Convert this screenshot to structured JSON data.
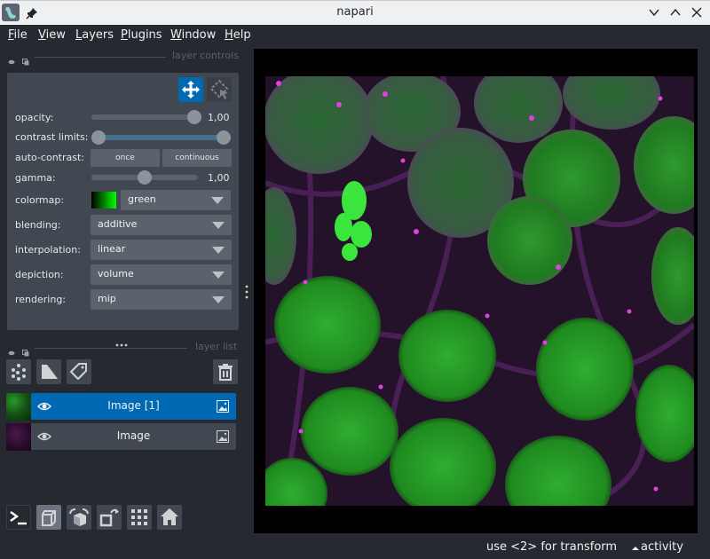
{
  "window": {
    "title": "napari",
    "buttons": {
      "minimize": "chevron-down",
      "maximize": "chevron-up",
      "close": "close"
    }
  },
  "menubar": {
    "items": [
      {
        "label": "File",
        "mnemonic": "F",
        "rest": "ile"
      },
      {
        "label": "View",
        "mnemonic": "V",
        "rest": "iew"
      },
      {
        "label": "Layers",
        "mnemonic": "L",
        "rest": "ayers"
      },
      {
        "label": "Plugins",
        "mnemonic": "P",
        "rest": "lugins"
      },
      {
        "label": "Window",
        "mnemonic": "W",
        "rest": "indow"
      },
      {
        "label": "Help",
        "mnemonic": "H",
        "rest": "elp"
      }
    ]
  },
  "layer_controls": {
    "dock_title": "layer controls",
    "modes": [
      {
        "name": "pan-zoom",
        "active": true
      },
      {
        "name": "transform",
        "active": false
      }
    ],
    "opacity": {
      "label": "opacity:",
      "value": 1.0,
      "display": "1,00"
    },
    "contrast_limits": {
      "label": "contrast limits:",
      "range": [
        0.0,
        1.0
      ]
    },
    "auto_contrast": {
      "label": "auto-contrast:",
      "buttons": [
        "once",
        "continuous"
      ]
    },
    "gamma": {
      "label": "gamma:",
      "value": 1.0,
      "display": "1,00",
      "fraction": 0.5
    },
    "colormap": {
      "label": "colormap:",
      "value": "green",
      "swatch_from": "#000000",
      "swatch_to": "#00ff00"
    },
    "blending": {
      "label": "blending:",
      "value": "additive"
    },
    "interpolation": {
      "label": "interpolation:",
      "value": "linear"
    },
    "depiction": {
      "label": "depiction:",
      "value": "volume"
    },
    "rendering": {
      "label": "rendering:",
      "value": "mip"
    }
  },
  "layer_list": {
    "dock_title": "layer list",
    "toolbar": [
      "new-points",
      "new-shapes",
      "new-labels",
      "delete-layer"
    ],
    "layers": [
      {
        "name": "Image [1]",
        "selected": true,
        "visible": true,
        "type": "image",
        "thumb_color": "#1f7a1f"
      },
      {
        "name": "Image",
        "selected": false,
        "visible": true,
        "type": "image",
        "thumb_color": "#3a0f3a"
      }
    ]
  },
  "viewer_buttons": [
    "console",
    "ndisplay-3d",
    "roll-dims",
    "transpose-dims",
    "grid-view",
    "reset-view"
  ],
  "statusbar": {
    "hint": "use <2> for transform",
    "activity": "activity"
  },
  "colors": {
    "accent": "#0069b4",
    "panel": "#414851",
    "background": "#262930",
    "widget": "#5b626c"
  }
}
